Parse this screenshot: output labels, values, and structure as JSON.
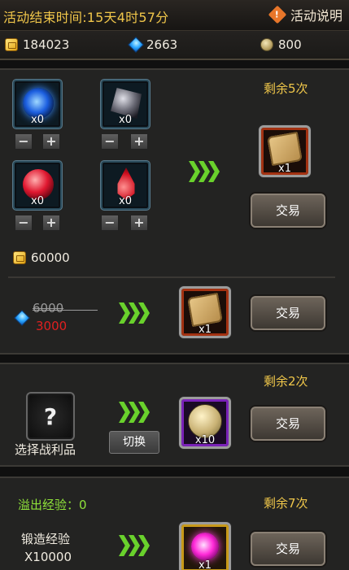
{
  "header": {
    "countdown": "活动结束时间:15天4时57分",
    "help_icon": "!",
    "help_label": "活动说明"
  },
  "resources": [
    {
      "icon": "gold-ingot-icon",
      "value": "184023"
    },
    {
      "icon": "blue-gem-icon",
      "value": "2663"
    },
    {
      "icon": "coin-icon",
      "value": "800"
    }
  ],
  "exchange1": {
    "remaining": "剩余5次",
    "materials": [
      {
        "icon": "blue-orb-icon",
        "count": "x0",
        "minus": "−",
        "plus": "+"
      },
      {
        "icon": "dark-ore-icon",
        "count": "x0",
        "minus": "−",
        "plus": "+"
      },
      {
        "icon": "red-orb-icon",
        "count": "x0",
        "minus": "−",
        "plus": "+"
      },
      {
        "icon": "red-drop-icon",
        "count": "x0",
        "minus": "−",
        "plus": "+"
      }
    ],
    "cost": "60000",
    "reward_count": "x1",
    "button": "交易"
  },
  "exchange2": {
    "old_price": "6000",
    "new_price": "3000",
    "reward_count": "x1",
    "button": "交易"
  },
  "exchange3": {
    "remaining": "剩余2次",
    "select_icon": "?",
    "select_label": "选择战利品",
    "switch_label": "切换",
    "reward_count": "x10",
    "button": "交易"
  },
  "exchange4": {
    "overflow": "溢出经验：0",
    "remaining": "剩余7次",
    "forge_label": "锻造经验",
    "forge_amount": "X10000",
    "reward_count": "x1",
    "button": "交易"
  },
  "colors": {
    "accent": "#f0c74a",
    "green": "#69d12c",
    "price_new": "#e02020",
    "overflow": "#8fe23a"
  }
}
